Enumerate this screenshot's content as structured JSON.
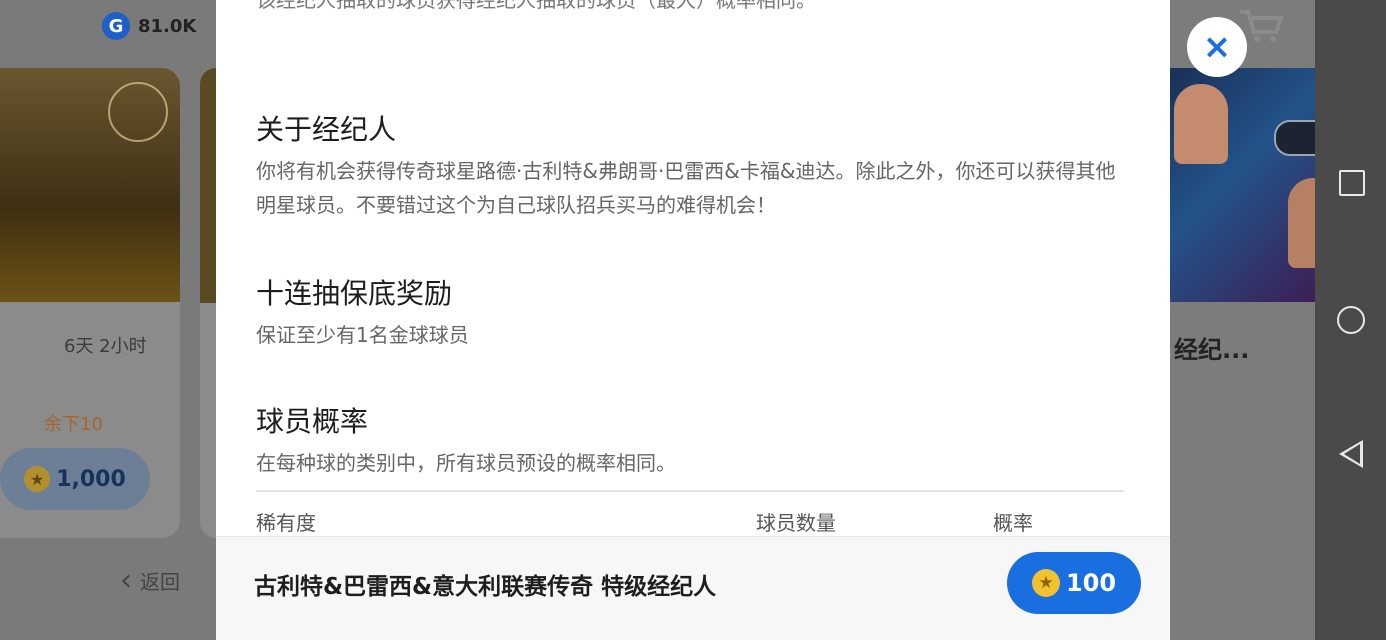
{
  "background": {
    "gp_balance": "81.0K",
    "gp_icon": "G",
    "left_card": {
      "time_left": "6天 2小时",
      "remaining": "余下10",
      "price": "1,000"
    },
    "back_label": "返回",
    "right_card": {
      "title": "经纪..."
    }
  },
  "modal": {
    "cut_text": "该经纪人抽取的球员获得经纪人抽取的球员（最大）概率相同。",
    "sections": [
      {
        "title": "关于经纪人",
        "body": "你将有机会获得传奇球星路德·古利特&弗朗哥·巴雷西&卡福&迪达。除此之外，你还可以获得其他明星球员。不要错过这个为自己球队招兵买马的难得机会！"
      },
      {
        "title": "十连抽保底奖励",
        "body": "保证至少有1名金球球员"
      },
      {
        "title": "球员概率",
        "body": "在每种球的类别中，所有球员预设的概率相同。"
      }
    ],
    "table_headers": {
      "rarity": "稀有度",
      "count": "球员数量",
      "probability": "概率"
    },
    "footer": {
      "title": "古利特&巴雷西&意大利联赛传奇 特级经纪人",
      "price": "100"
    }
  },
  "close_icon": "×",
  "colors": {
    "accent": "#1a6fe0",
    "coin": "#f2c12e"
  }
}
